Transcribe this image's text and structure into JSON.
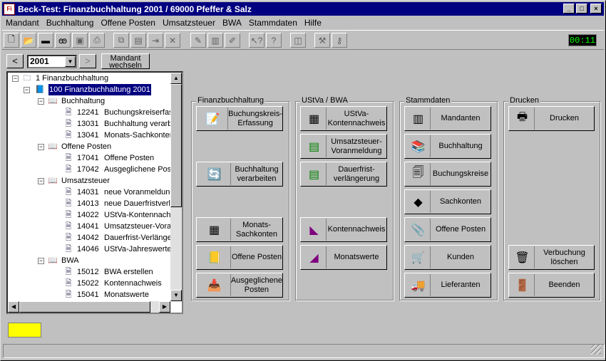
{
  "window": {
    "app_icon": "Fi",
    "title": "Beck-Test: Finanzbuchhaltung 2001 / 69000 Pfeffer & Salz",
    "controls": [
      "minimize-icon",
      "maximize-icon",
      "close-icon"
    ]
  },
  "menu": [
    "Mandant",
    "Buchhaltung",
    "Offene Posten",
    "Umsatzsteuer",
    "BWA",
    "Stammdaten",
    "Hilfe"
  ],
  "toolbar": {
    "icons": [
      "new-document-icon",
      "open-folder-icon",
      "folder-icon",
      "binoculars-icon",
      "save-icon",
      "print-icon",
      "copy-icon",
      "paste-icon",
      "export-icon",
      "delete-icon",
      "stamp-icon",
      "book-icon",
      "notes-icon",
      "context-help-icon",
      "help-icon",
      "window-icon",
      "tools-icon",
      "key-icon"
    ],
    "clock": "00:11"
  },
  "nav": {
    "prev": "<",
    "year": "2001",
    "next": ">",
    "mandant_button": [
      "Mandant",
      "wechseln"
    ]
  },
  "tree": [
    {
      "label": "1 Finanzbuchhaltung"
    },
    {
      "label": "100 Finanzbuchhaltung 2001",
      "selected": true
    },
    {
      "label": "Buchhaltung"
    },
    {
      "num": "12241",
      "label": "Buchungskreiserfas"
    },
    {
      "num": "13031",
      "label": "Buchhaltung verarb"
    },
    {
      "num": "13041",
      "label": "Monats-Sachkonter"
    },
    {
      "label": "Offene Posten"
    },
    {
      "num": "17041",
      "label": "Offene Posten"
    },
    {
      "num": "17042",
      "label": "Ausgeglichene Post"
    },
    {
      "label": "Umsatzsteuer"
    },
    {
      "num": "14031",
      "label": "neue Voranmeldung"
    },
    {
      "num": "14013",
      "label": "neue Dauerfristverlä"
    },
    {
      "num": "14022",
      "label": "UStVa-Kontennach"
    },
    {
      "num": "14041",
      "label": "Umsatzsteuer-Vorar"
    },
    {
      "num": "14042",
      "label": "Dauerfrist-Verlänger"
    },
    {
      "num": "14046",
      "label": "UStVa-Jahreswerte"
    },
    {
      "label": "BWA"
    },
    {
      "num": "15012",
      "label": "BWA erstellen"
    },
    {
      "num": "15022",
      "label": "Kontennachweis"
    },
    {
      "num": "15041",
      "label": "Monatswerte"
    }
  ],
  "groups": {
    "fibu": {
      "title": "Finanzbuchhaltung",
      "buttons": [
        {
          "label": "Buchungskreis-\nErfassung",
          "icon": "entry-form-icon"
        },
        {
          "label": "Buchhaltung\nverarbeiten",
          "icon": "process-icon"
        },
        {
          "label": "Monats-\nSachkonten",
          "icon": "ledger-icon"
        },
        {
          "label": "Offene Posten",
          "icon": "open-items-icon"
        },
        {
          "label": "Ausgeglichene\nPosten",
          "icon": "tray-icon"
        }
      ]
    },
    "ustva": {
      "title": "UStVa / BWA",
      "buttons": [
        {
          "label": "UStVa-\nKontennachweis",
          "icon": "ledger-icon"
        },
        {
          "label": "Umsatzsteuer-\nVoranmeldung",
          "icon": "cabinet-icon"
        },
        {
          "label": "Dauerfrist-\nverlängerung",
          "icon": "cabinet-icon"
        },
        {
          "label": "Kontennachweis",
          "icon": "chart-ledger-icon"
        },
        {
          "label": "Monatswerte",
          "icon": "trend-icon"
        }
      ]
    },
    "stamm": {
      "title": "Stammdaten",
      "buttons": [
        {
          "label": "Mandanten",
          "icon": "binders-icon"
        },
        {
          "label": "Buchhaltung",
          "icon": "books-icon"
        },
        {
          "label": "Buchungskreise",
          "icon": "documents-icon"
        },
        {
          "label": "Sachkonten",
          "icon": "shapes-icon"
        },
        {
          "label": "Offene Posten",
          "icon": "clip-icon"
        },
        {
          "label": "Kunden",
          "icon": "cart-icon"
        },
        {
          "label": "Lieferanten",
          "icon": "truck-icon"
        }
      ]
    },
    "drucken": {
      "title": "Drucken",
      "buttons": [
        {
          "label": "Drucken",
          "icon": "printer-icon"
        },
        {
          "label": "Verbuchung\nlöschen",
          "icon": "trash-icon"
        },
        {
          "label": "Beenden",
          "icon": "exit-door-icon"
        }
      ]
    }
  },
  "status": {
    "indicator_color": "#ffff00"
  }
}
